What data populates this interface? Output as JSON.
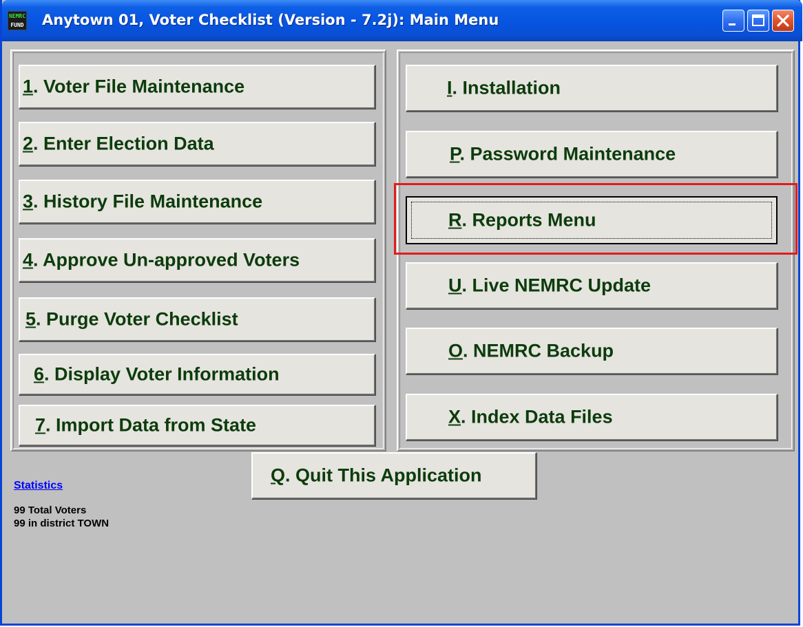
{
  "window": {
    "title": "Anytown 01, Voter Checklist (Version - 7.2j):  Main Menu",
    "icon_top": "NEMRC",
    "icon_bottom": "FUND"
  },
  "left_menu": [
    {
      "key": "1",
      "rest": ". Voter File Maintenance"
    },
    {
      "key": "2",
      "rest": ". Enter Election Data"
    },
    {
      "key": "3",
      "rest": ". History File Maintenance"
    },
    {
      "key": "4",
      "rest": ". Approve Un-approved Voters"
    },
    {
      "key": "5",
      "rest": ". Purge Voter Checklist"
    },
    {
      "key": "6",
      "rest": ". Display Voter Information"
    },
    {
      "key": "7",
      "rest": ". Import Data from State"
    }
  ],
  "right_menu": [
    {
      "key": "I",
      "rest": ". Installation"
    },
    {
      "key": "P",
      "rest": ". Password Maintenance"
    },
    {
      "key": "R",
      "rest": ". Reports Menu"
    },
    {
      "key": "U",
      "rest": ". Live NEMRC Update"
    },
    {
      "key": "O",
      "rest": ". NEMRC Backup"
    },
    {
      "key": "X",
      "rest": ". Index Data Files"
    }
  ],
  "quit": {
    "key": "Q",
    "rest": ". Quit This Application"
  },
  "statistics": {
    "link": "Statistics",
    "lines": [
      "99 Total Voters",
      "99 in district TOWN"
    ]
  },
  "colors": {
    "titlebar": "#0654e0",
    "button_text": "#0c3c0c",
    "highlight": "#e31b1b",
    "background": "#c0c0c0"
  }
}
